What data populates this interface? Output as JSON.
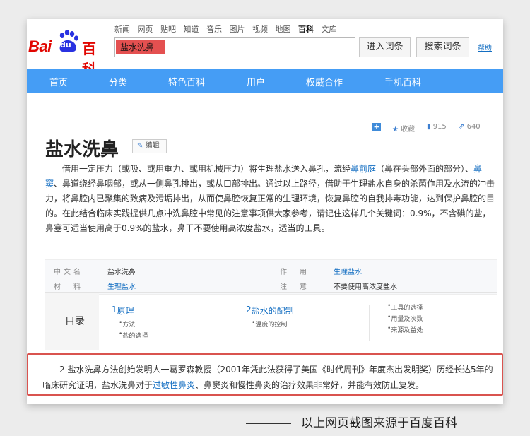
{
  "header": {
    "top_links": [
      "新闻",
      "网页",
      "贴吧",
      "知道",
      "音乐",
      "图片",
      "视频",
      "地图",
      "百科",
      "文库"
    ],
    "active_link": "百科",
    "logo": {
      "bai": "Bai",
      "du": "du",
      "baike": "百科"
    },
    "search_value": "盐水洗鼻",
    "enter_button": "进入词条",
    "search_button": "搜索词条",
    "help": "帮助"
  },
  "navbar": [
    "首页",
    "分类",
    "特色百科",
    "用户",
    "权威合作",
    "手机百科"
  ],
  "article": {
    "actions": {
      "add": "+",
      "fav": "收藏",
      "likes": "915",
      "shares": "640"
    },
    "title": "盐水洗鼻",
    "edit": "编辑",
    "summary": {
      "p1": "借用一定压力（或吸、或用重力、或用机械压力）将生理盐水送入鼻孔，流经",
      "link1": "鼻前庭",
      "p2": "（鼻在头部外面的部分）、",
      "link2": "鼻窦",
      "p3": "、鼻道绕经鼻咽部，或从一侧鼻孔排出，或从口部排出。通过以上路径，借助于生理盐水自身的杀菌作用及水流的冲击力，将鼻腔内已聚集的致病及污垢排出，从而使鼻腔恢复正常的生理环境，恢复鼻腔的自我排毒功能，达到保护鼻腔的目的。在此结合临床实践提供几点冲洗鼻腔中常见的注意事项供大家参考，请记住这样几个关键词：0.9%，不含碘的盐，鼻塞可适当使用高于0.9%的盐水，鼻干不要使用高浓度盐水，适当的工具。"
    },
    "basic_info": [
      {
        "key": "中文名",
        "value": "盐水洗鼻"
      },
      {
        "key": "作　用",
        "value": "生理盐水"
      },
      {
        "key": "材　料",
        "value": "生理盐水"
      },
      {
        "key": "注　意",
        "value": "不要使用高浓度盐水"
      }
    ],
    "toc": {
      "label": "目录",
      "sections": [
        {
          "num": "1",
          "title": "原理",
          "subs": [
            "方法",
            "盐的选择"
          ]
        },
        {
          "num": "2",
          "title": "盐水的配制",
          "subs": [
            "温度的控制"
          ]
        }
      ],
      "extra": [
        "工具的选择",
        "用量及次数",
        "来源及益处"
      ]
    }
  },
  "highlight": {
    "t1": "2 盐水洗鼻方法创始发明人一葛罗森教授（2001年凭此法获得了美国《时代周刊》年度杰出发明奖）历经长达5年的临床研究证明，盐水洗鼻对于",
    "link": "过敏性鼻炎",
    "t2": "、鼻窦炎和慢性鼻炎的治疗效果非常好，并能有效防止复发。"
  },
  "caption": "以上网页截图来源于百度百科",
  "colors": {
    "brand_red": "#e10601",
    "nav_blue": "#459df5",
    "link_blue": "#136ec2",
    "highlight_border": "#d9534f"
  }
}
